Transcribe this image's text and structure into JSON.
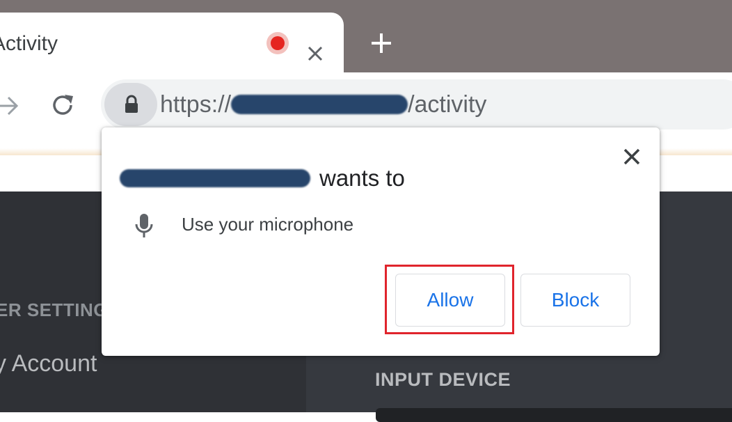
{
  "tab": {
    "title": "Activity",
    "recording_icon": "recording-dot-icon",
    "close_icon": "close-icon"
  },
  "new_tab_icon": "plus-icon",
  "toolbar": {
    "forward_icon": "forward-arrow-icon",
    "reload_icon": "reload-icon",
    "lock_icon": "lock-icon",
    "url_scheme": "https://",
    "url_path": "/activity"
  },
  "permission_prompt": {
    "wants_to": "wants to",
    "permission_text": "Use your microphone",
    "mic_icon": "microphone-icon",
    "allow_label": "Allow",
    "block_label": "Block",
    "close_icon": "close-icon"
  },
  "app": {
    "sidebar_heading": "ER SETTING",
    "sidebar_item": "y Account",
    "input_device_label": "INPUT DEVICE"
  },
  "colors": {
    "highlight_border": "#e0242c",
    "button_text": "#1a73e8",
    "tabstrip": "#7a7272",
    "app_background": "#36393f"
  }
}
